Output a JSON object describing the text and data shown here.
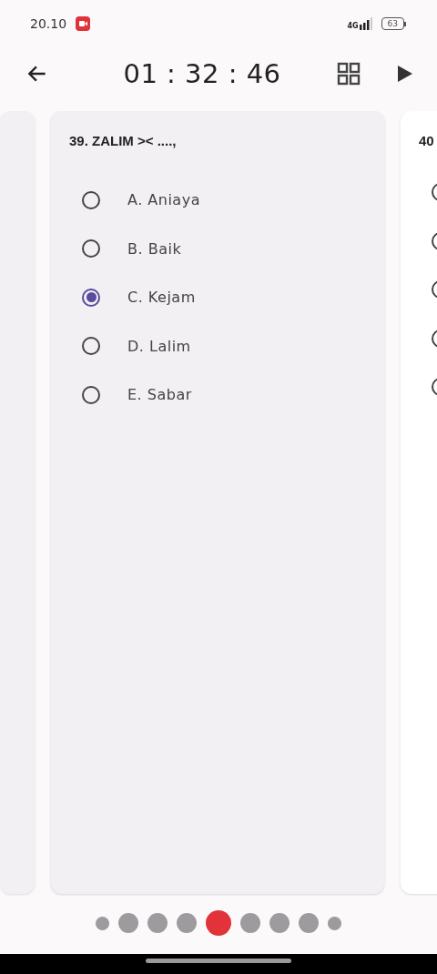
{
  "status_bar": {
    "time": "20.10",
    "network": "4G",
    "battery": "63"
  },
  "toolbar": {
    "timer": "01 : 32 : 46"
  },
  "question": {
    "title": "39. ZALIM >< ....,",
    "options": [
      {
        "label": "A. Aniaya",
        "selected": false
      },
      {
        "label": "B. Baik",
        "selected": false
      },
      {
        "label": "C. Kejam",
        "selected": true
      },
      {
        "label": "D. Lalim",
        "selected": false
      },
      {
        "label": "E. Sabar",
        "selected": false
      }
    ]
  },
  "next_question": {
    "title": "40",
    "options": [
      {
        "selected": false
      },
      {
        "selected": false
      },
      {
        "selected": false
      },
      {
        "selected": false
      },
      {
        "selected": false
      }
    ]
  },
  "pager": [
    {
      "kind": "small",
      "selected": false
    },
    {
      "kind": "large",
      "selected": false
    },
    {
      "kind": "large",
      "selected": false
    },
    {
      "kind": "large",
      "selected": false
    },
    {
      "kind": "large",
      "selected": true
    },
    {
      "kind": "large",
      "selected": false
    },
    {
      "kind": "large",
      "selected": false
    },
    {
      "kind": "large",
      "selected": false
    },
    {
      "kind": "small",
      "selected": false
    }
  ]
}
